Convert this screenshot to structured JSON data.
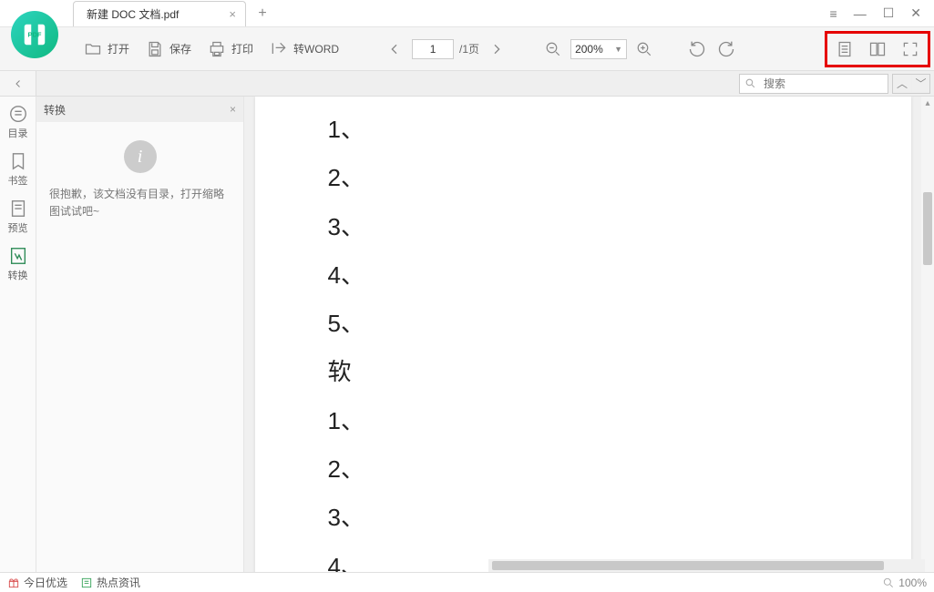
{
  "tab": {
    "title": "新建 DOC 文档.pdf"
  },
  "toolbar": {
    "open": "打开",
    "save": "保存",
    "print": "打印",
    "toword": "转WORD",
    "page_current": "1",
    "page_total": "/1页",
    "zoom": "200%"
  },
  "sidebar_strip": {
    "toc": "目录",
    "bookmark": "书签",
    "preview": "预览",
    "convert": "转换"
  },
  "panel": {
    "title": "转换",
    "message": "很抱歉，该文档没有目录，打开缩略图试试吧~"
  },
  "search": {
    "placeholder": "搜索"
  },
  "document": {
    "lines": [
      "1、",
      "2、",
      "3、",
      "4、",
      "5、",
      "软",
      "1、",
      "2、",
      "3、",
      "4、"
    ]
  },
  "status": {
    "left1": "今日优选",
    "left2": "热点资讯",
    "zoom": "100%"
  }
}
